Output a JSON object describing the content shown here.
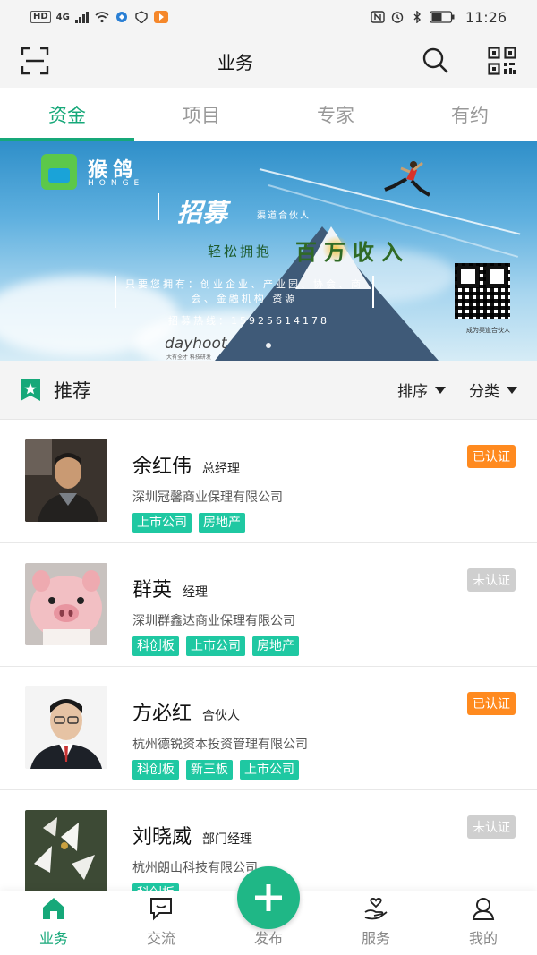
{
  "status_bar": {
    "left_badges": [
      "HD",
      "4G"
    ],
    "time": "11:26"
  },
  "header": {
    "title": "业务",
    "left_icon": "scan-icon",
    "right_icons": [
      "search-icon",
      "qrcode-icon"
    ]
  },
  "tabs": [
    {
      "label": "资金",
      "active": true
    },
    {
      "label": "项目",
      "active": false
    },
    {
      "label": "专家",
      "active": false
    },
    {
      "label": "有约",
      "active": false
    }
  ],
  "banner": {
    "logo_text": "猴鸽",
    "logo_sub": "HONGE",
    "title": "招募",
    "title_sub": "渠道合伙人",
    "line1": "轻松拥抱",
    "line1_emphasis": "百万收入",
    "desc": "只要您拥有：创业企业、产业园、协会、商会、金融机构 资源",
    "phone": "招募热线：15925614178",
    "brand": "dayhoot",
    "brand_sub": "大有全才  科技研发",
    "qr_caption": "成为渠道合伙人"
  },
  "section": {
    "title": "推荐",
    "sort_label": "排序",
    "category_label": "分类"
  },
  "people": [
    {
      "name": "余红伟",
      "role": "总经理",
      "company": "深圳冠馨商业保理有限公司",
      "tags": [
        "上市公司",
        "房地产"
      ],
      "badge": "已认证",
      "verified": true
    },
    {
      "name": "群英",
      "role": "经理",
      "company": "深圳群鑫达商业保理有限公司",
      "tags": [
        "科创板",
        "上市公司",
        "房地产"
      ],
      "badge": "未认证",
      "verified": false
    },
    {
      "name": "方必红",
      "role": "合伙人",
      "company": "杭州德锐资本投资管理有限公司",
      "tags": [
        "科创板",
        "新三板",
        "上市公司"
      ],
      "badge": "已认证",
      "verified": true
    },
    {
      "name": "刘晓威",
      "role": "部门经理",
      "company": "杭州朗山科技有限公司",
      "tags": [
        "科创板"
      ],
      "badge": "未认证",
      "verified": false
    }
  ],
  "bottom_nav": [
    {
      "label": "业务",
      "icon": "home-icon",
      "active": true
    },
    {
      "label": "交流",
      "icon": "chat-icon",
      "active": false
    },
    {
      "label": "发布",
      "icon": "plus-icon",
      "active": false
    },
    {
      "label": "服务",
      "icon": "service-icon",
      "active": false
    },
    {
      "label": "我的",
      "icon": "user-icon",
      "active": false
    }
  ],
  "colors": {
    "accent": "#16a879",
    "tag": "#1fc8a2",
    "verified": "#ff8a1f",
    "unverified": "#cfcfcf"
  }
}
